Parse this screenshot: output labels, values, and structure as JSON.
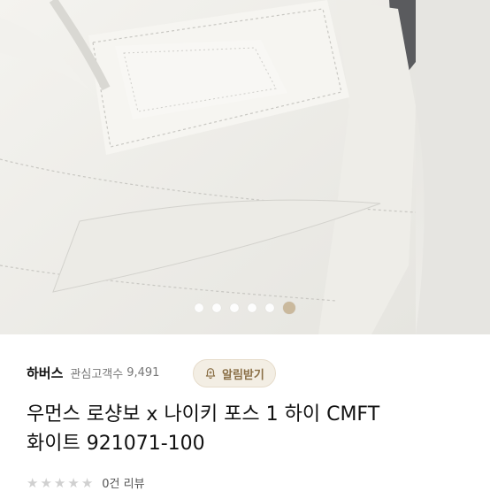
{
  "carousel": {
    "slide_count": 6,
    "active_index": 5,
    "accent_color": "#c9b79a"
  },
  "shop": {
    "name": "하버스",
    "follower_label": "관심고객수",
    "follower_count": "9,491",
    "alert_button_label": "알림받기"
  },
  "product": {
    "title_line1": "우먼스 로샹보 x 나이키 포스 1 하이 CMFT",
    "title_line2": "화이트 921071-100"
  },
  "rating": {
    "stars": 0,
    "review_count_label": "0건 리뷰"
  }
}
